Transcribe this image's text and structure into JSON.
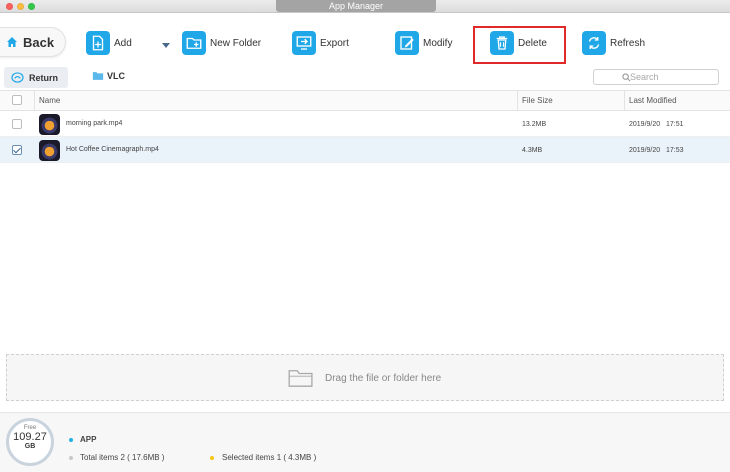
{
  "window": {
    "title": "App Manager"
  },
  "toolbar": {
    "back_label": "Back",
    "add_label": "Add",
    "new_folder_label": "New Folder",
    "export_label": "Export",
    "modify_label": "Modify",
    "delete_label": "Delete",
    "refresh_label": "Refresh"
  },
  "nav": {
    "return_label": "Return",
    "folder_label": "VLC",
    "search_placeholder": "Search"
  },
  "table": {
    "headers": {
      "name": "Name",
      "size": "File Size",
      "modified": "Last Modified"
    },
    "rows": [
      {
        "name": "morning park.mp4",
        "size": "13.2MB",
        "date": "2019/9/20",
        "time": "17:51",
        "checked": false
      },
      {
        "name": "Hot Coffee Cinemagraph.mp4",
        "size": "4.3MB",
        "date": "2019/9/20",
        "time": "17:53",
        "checked": true
      }
    ]
  },
  "dropzone": {
    "label": "Drag the file or folder here"
  },
  "footer": {
    "free_label": "Free",
    "free_amount": "109.27",
    "free_unit": "GB",
    "category": "APP",
    "total_items": "Total items 2 ( 17.6MB )",
    "selected_items": "Selected items 1 ( 4.3MB )"
  },
  "colors": {
    "accent": "#1fa7e8",
    "highlight_border": "#e02a2a",
    "app_dot": "#21b3e3",
    "selected_dot": "#f5c518",
    "total_dot": "#c8c8c8"
  },
  "icons": {
    "back": "home-icon",
    "add": "add-file-icon",
    "new_folder": "new-folder-icon",
    "export": "export-icon",
    "modify": "edit-icon",
    "delete": "trash-icon",
    "refresh": "refresh-icon",
    "search": "search-icon",
    "dropzone": "folder-outline-icon"
  }
}
